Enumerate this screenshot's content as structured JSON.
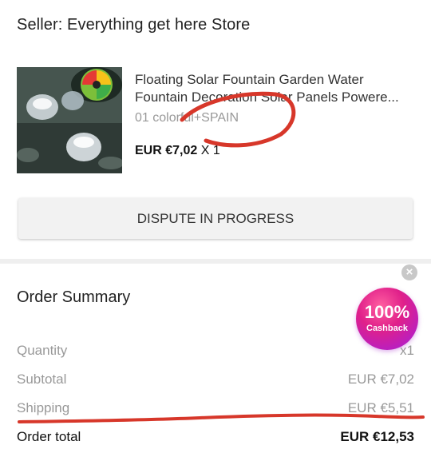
{
  "seller": {
    "label": "Seller: Everything get here Store"
  },
  "product": {
    "title": "Floating Solar Fountain Garden Water Fountain Decoration Solar Panels Powere...",
    "variant": "01 colorful+SPAIN",
    "price": "EUR €7,02",
    "quantity": "X 1"
  },
  "dispute": {
    "label": "DISPUTE IN PROGRESS"
  },
  "summary": {
    "title": "Order Summary",
    "rows": [
      {
        "label": "Quantity",
        "value": "x1"
      },
      {
        "label": "Subtotal",
        "value": "EUR €7,02"
      },
      {
        "label": "Shipping",
        "value": "EUR €5,51"
      },
      {
        "label": "Order total",
        "value": "EUR €12,53"
      }
    ]
  },
  "cashback": {
    "percent": "100%",
    "label": "Cashback"
  },
  "colors": {
    "annotation": "#d7372a",
    "cashback_pink": "#e0208a",
    "cashback_purple": "#a21ee0"
  },
  "icons": {
    "close": "close-icon",
    "product_image": "solar-fountain-thumbnail"
  }
}
